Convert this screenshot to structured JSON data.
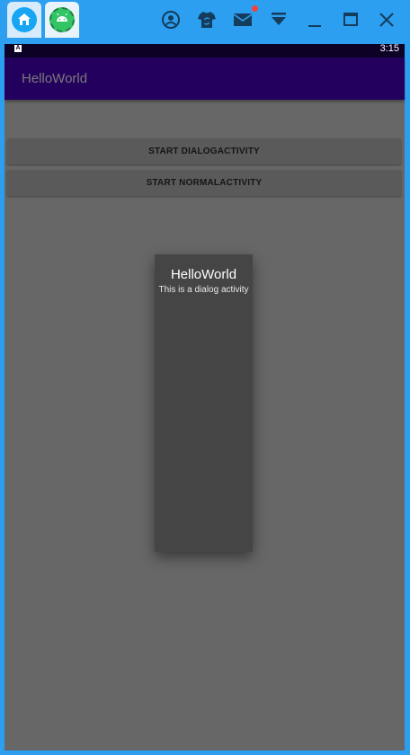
{
  "emulator": {
    "tabs": [
      {
        "name": "home-tab"
      },
      {
        "name": "android-tab"
      }
    ],
    "toolbar_icons": [
      "account-icon",
      "shirt-icon",
      "mail-icon",
      "dropdown-icon",
      "minimize-icon",
      "maximize-icon",
      "close-icon"
    ],
    "notification_dot_color": "#f44336"
  },
  "status_bar": {
    "indicator": "A",
    "time": "3:15"
  },
  "app_bar": {
    "title": "HelloWorld",
    "color": "#24005e"
  },
  "buttons": {
    "start_dialog": "START DIALOGACTIVITY",
    "start_normal": "START NORMALACTIVITY"
  },
  "dialog": {
    "title": "HelloWorld",
    "message": "This is a dialog activity"
  }
}
